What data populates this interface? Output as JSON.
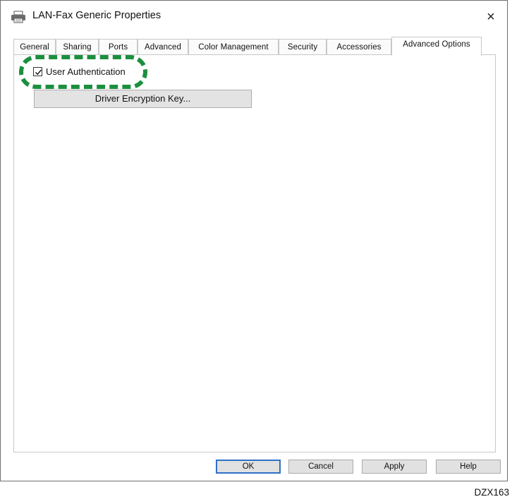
{
  "window": {
    "title": "LAN-Fax Generic Properties",
    "close_glyph": "×",
    "icon": "printer-icon"
  },
  "tabs": [
    {
      "label": "General",
      "active": false
    },
    {
      "label": "Sharing",
      "active": false
    },
    {
      "label": "Ports",
      "active": false
    },
    {
      "label": "Advanced",
      "active": false
    },
    {
      "label": "Color Management",
      "active": false
    },
    {
      "label": "Security",
      "active": false
    },
    {
      "label": "Accessories",
      "active": false
    },
    {
      "label": "Advanced Options",
      "active": true
    }
  ],
  "options": {
    "user_auth": {
      "label": "User Authentication",
      "checked": true
    },
    "encryption_button": "Driver Encryption Key..."
  },
  "buttons": {
    "ok": "OK",
    "cancel": "Cancel",
    "apply": "Apply",
    "help": "Help"
  },
  "footer": {
    "code": "DZX163"
  },
  "colors": {
    "highlight": "#1c8f3f",
    "default_button_border": "#2f70c6"
  }
}
